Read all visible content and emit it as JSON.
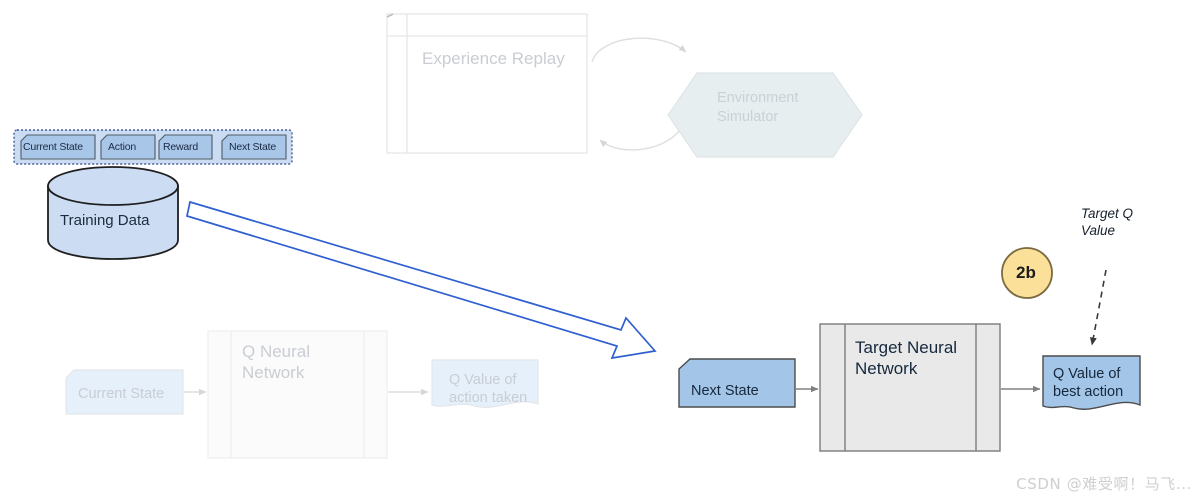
{
  "diagram": {
    "title": "DQN Target Network Training Diagram",
    "colors": {
      "tag_fill": "#a8c6e8",
      "tag_stroke": "#4f5b68",
      "group_fill": "#c9dcf2",
      "group_stroke": "#4a5a9e",
      "cylinder_fill": "#cbdcf3",
      "cylinder_stroke": "#1f1f1f",
      "blue_arrow": "#2f5fd0",
      "process_fill": "#e9e9e9",
      "process_stroke": "#7a7a7a",
      "next_state_fill": "#a3c5e7",
      "next_state_stroke": "#4c4c4c",
      "badge_fill": "#fbe09a",
      "badge_stroke": "#7a6a40",
      "faded_blue_fill": "#e6f0fa",
      "faded_stroke": "#e2e6ea",
      "faded_text": "#c9cdd3",
      "hex_fill": "#e6eef0",
      "watermark": "#cfcfcf"
    },
    "replay_group": {
      "table_label": "Experience Replay",
      "hexagon_label_line1": "Environment",
      "hexagon_label_line2": "Simulator"
    },
    "transition_tags": [
      {
        "label": "Current State"
      },
      {
        "label": "Action"
      },
      {
        "label": "Reward"
      },
      {
        "label": "Next State"
      }
    ],
    "training_data": {
      "label": "Training Data"
    },
    "online_branch": {
      "input_label": "Current State",
      "network_line1": "Q Neural",
      "network_line2": "Network",
      "output_line1": "Q Value of",
      "output_line2": "action taken"
    },
    "target_branch": {
      "input_label": "Next State",
      "network_line1": "Target Neural",
      "network_line2": "Network",
      "output_line1": "Q Value of",
      "output_line2": "best action"
    },
    "step_badge": {
      "label": "2b"
    },
    "target_q": {
      "line1": "Target Q",
      "line2": "Value"
    },
    "watermark": {
      "text": "CSDN @难受啊！马飞..."
    }
  }
}
